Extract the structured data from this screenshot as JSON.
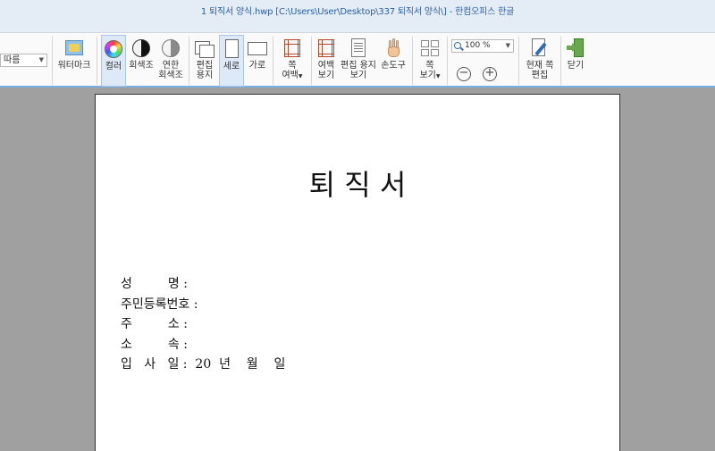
{
  "window": {
    "title": "1 퇴직서 양식.hwp [C:\\Users\\User\\Desktop\\337 퇴직서 양식\\] - 한컴오피스 한글"
  },
  "ribbon": {
    "dropdown_value": "따름",
    "watermark": "워터마크",
    "color": "컬러",
    "grayscale": "회색조",
    "light_gray_1": "연한",
    "light_gray_2": "회색조",
    "edit_paper_1": "편집",
    "edit_paper_2": "용지",
    "portrait": "세로",
    "landscape": "가로",
    "page_margin_1": "쪽",
    "page_margin_2": "여백",
    "margin_view_1": "여백",
    "margin_view_2": "보기",
    "edit_paper_view_1": "편집 용지",
    "edit_paper_view_2": "보기",
    "hand_tool": "손도구",
    "page_view_1": "쪽",
    "page_view_2": "보기",
    "zoom_value": "100 %",
    "zoom_out": "−",
    "zoom_in": "+",
    "edit_current_1": "현재 쪽",
    "edit_current_2": "편집",
    "close": "닫기"
  },
  "document": {
    "title": "퇴   직   서",
    "fields": [
      "성         명 :",
      "주민등록번호 :",
      "주         소 :",
      "소         속 :",
      "입   사   일 :  20  년    월    일"
    ]
  },
  "colors": {
    "titlebar_bg": "#e4ecf5",
    "title_text": "#2a5fa8",
    "ribbon_bottom": "#7aaee0",
    "workspace_bg": "#a0a0a0"
  }
}
